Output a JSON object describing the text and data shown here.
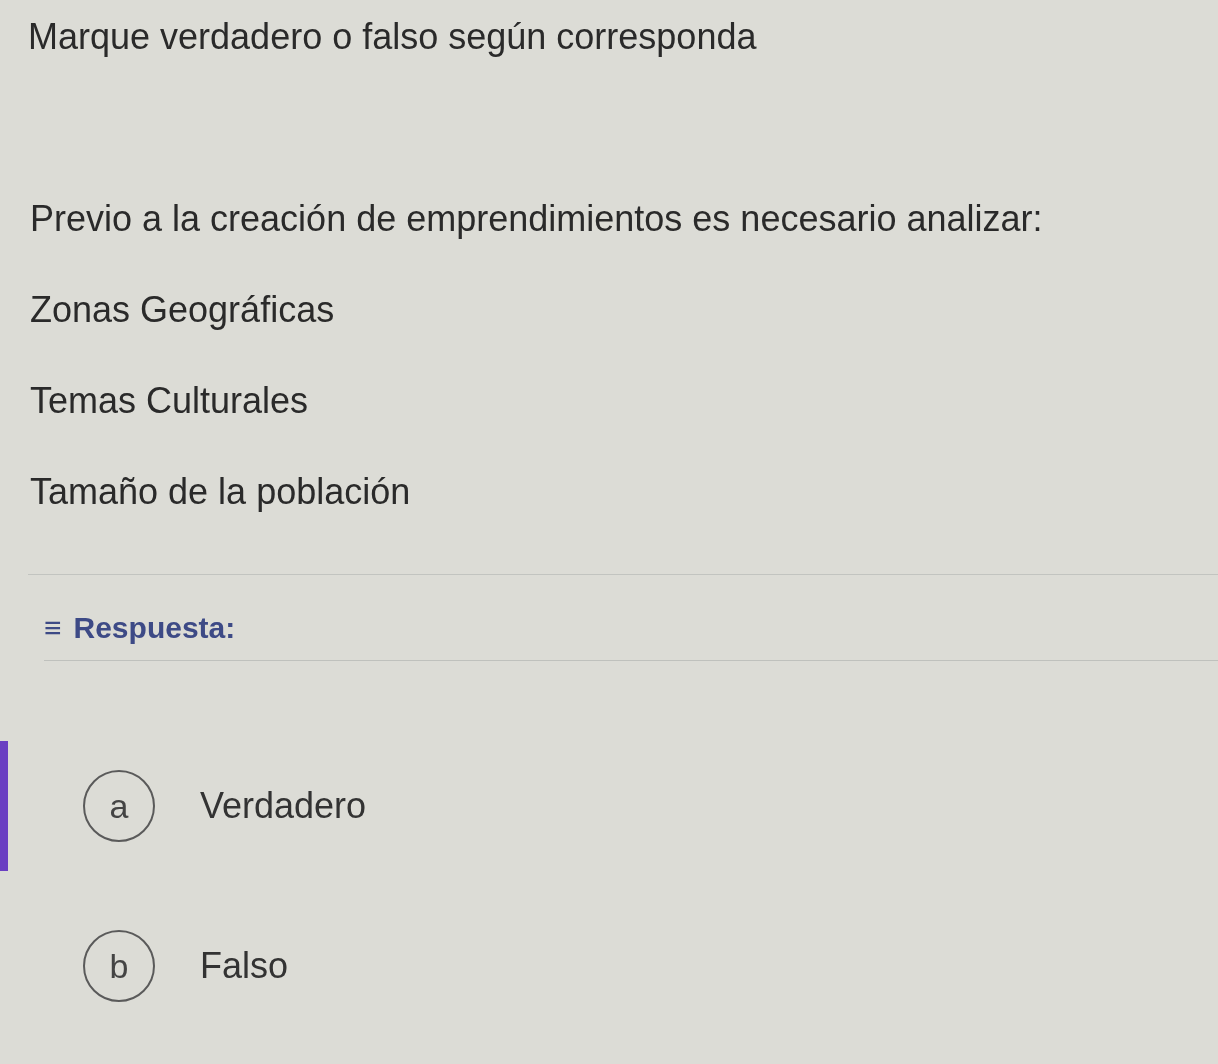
{
  "instruction": "Marque verdadero o falso según corresponda",
  "question": "Previo a la creación de emprendimientos es necesario analizar:",
  "items": [
    "Zonas Geográficas",
    "Temas Culturales",
    "Tamaño de la población"
  ],
  "answer_label": {
    "icon": "≡",
    "text": "Respuesta:"
  },
  "options": [
    {
      "letter": "a",
      "label": "Verdadero",
      "selected": true
    },
    {
      "letter": "b",
      "label": "Falso",
      "selected": false
    }
  ]
}
